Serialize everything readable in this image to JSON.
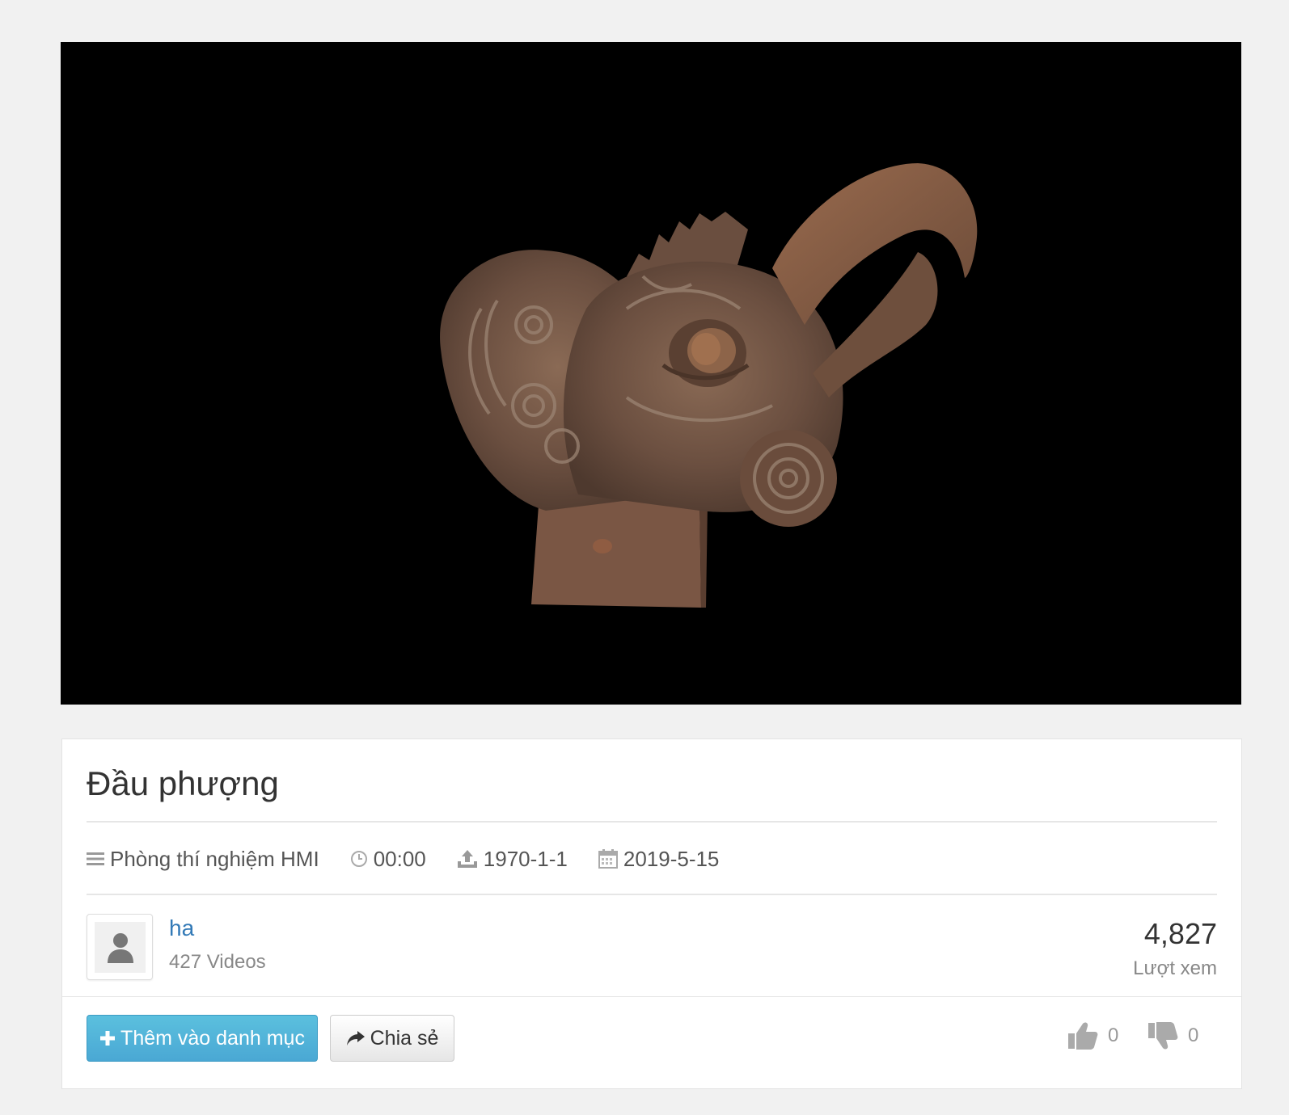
{
  "video": {
    "title": "Đầu phượng",
    "category": "Phòng thí nghiệm HMI",
    "duration": "00:00",
    "uploaded": "1970-1-1",
    "date": "2019-5-15"
  },
  "author": {
    "name": "ha",
    "video_count": "427 Videos"
  },
  "stats": {
    "views": "4,827",
    "views_label": "Lượt xem",
    "likes": "0",
    "dislikes": "0"
  },
  "actions": {
    "add_label": "Thêm vào danh mục",
    "share_label": "Chia sẻ"
  },
  "icons": {
    "category": "list-icon",
    "duration": "clock-icon",
    "uploaded": "upload-icon",
    "date": "calendar-icon",
    "avatar": "user-icon",
    "add": "plus-icon",
    "share": "share-icon",
    "like": "thumbs-up-icon",
    "dislike": "thumbs-down-icon"
  },
  "colors": {
    "primary_button": "#5bc0de",
    "link": "#337ab7",
    "player_background": "#000000"
  }
}
